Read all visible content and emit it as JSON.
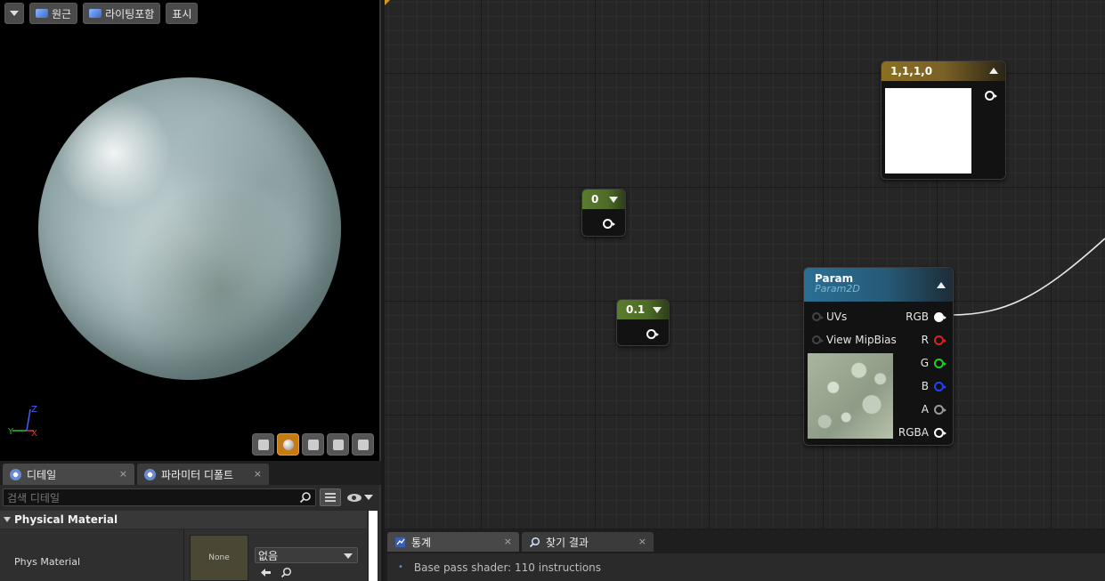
{
  "viewport": {
    "toolbar": {
      "perspective_label": "원근",
      "lit_label": "라이팅포함",
      "show_label": "표시"
    },
    "axis": {
      "x": "X",
      "y": "Y",
      "z": "Z"
    }
  },
  "details_panel": {
    "tabs": [
      {
        "label": "디테일",
        "close": "×"
      },
      {
        "label": "파라미터 디폴트",
        "close": "×"
      }
    ],
    "search_placeholder": "검색 디테일",
    "category": "Physical Material",
    "property": {
      "name": "Phys Material",
      "thumbnail_label": "None",
      "combo_value": "없음"
    }
  },
  "graph": {
    "nodes": {
      "const_zero": {
        "title": "0"
      },
      "const_point_one": {
        "title": "0.1"
      },
      "const_vector": {
        "title": "1,1,1,0",
        "swatch_color": "#ffffff"
      },
      "param": {
        "title": "Param",
        "subtitle": "Param2D",
        "inputs": [
          "UVs",
          "View MipBias"
        ],
        "outputs": [
          {
            "label": "RGB",
            "color": "#ffffff"
          },
          {
            "label": "R",
            "color": "#e02020"
          },
          {
            "label": "G",
            "color": "#20d020"
          },
          {
            "label": "B",
            "color": "#2040ff"
          },
          {
            "label": "A",
            "color": "#9a9a9a"
          },
          {
            "label": "RGBA",
            "color": "#ffffff"
          }
        ]
      }
    }
  },
  "bottom_panel": {
    "tabs": [
      {
        "label": "통계",
        "close": "×"
      },
      {
        "label": "찾기 결과",
        "close": "×"
      }
    ],
    "log_line": "Base pass shader: 110 instructions"
  }
}
